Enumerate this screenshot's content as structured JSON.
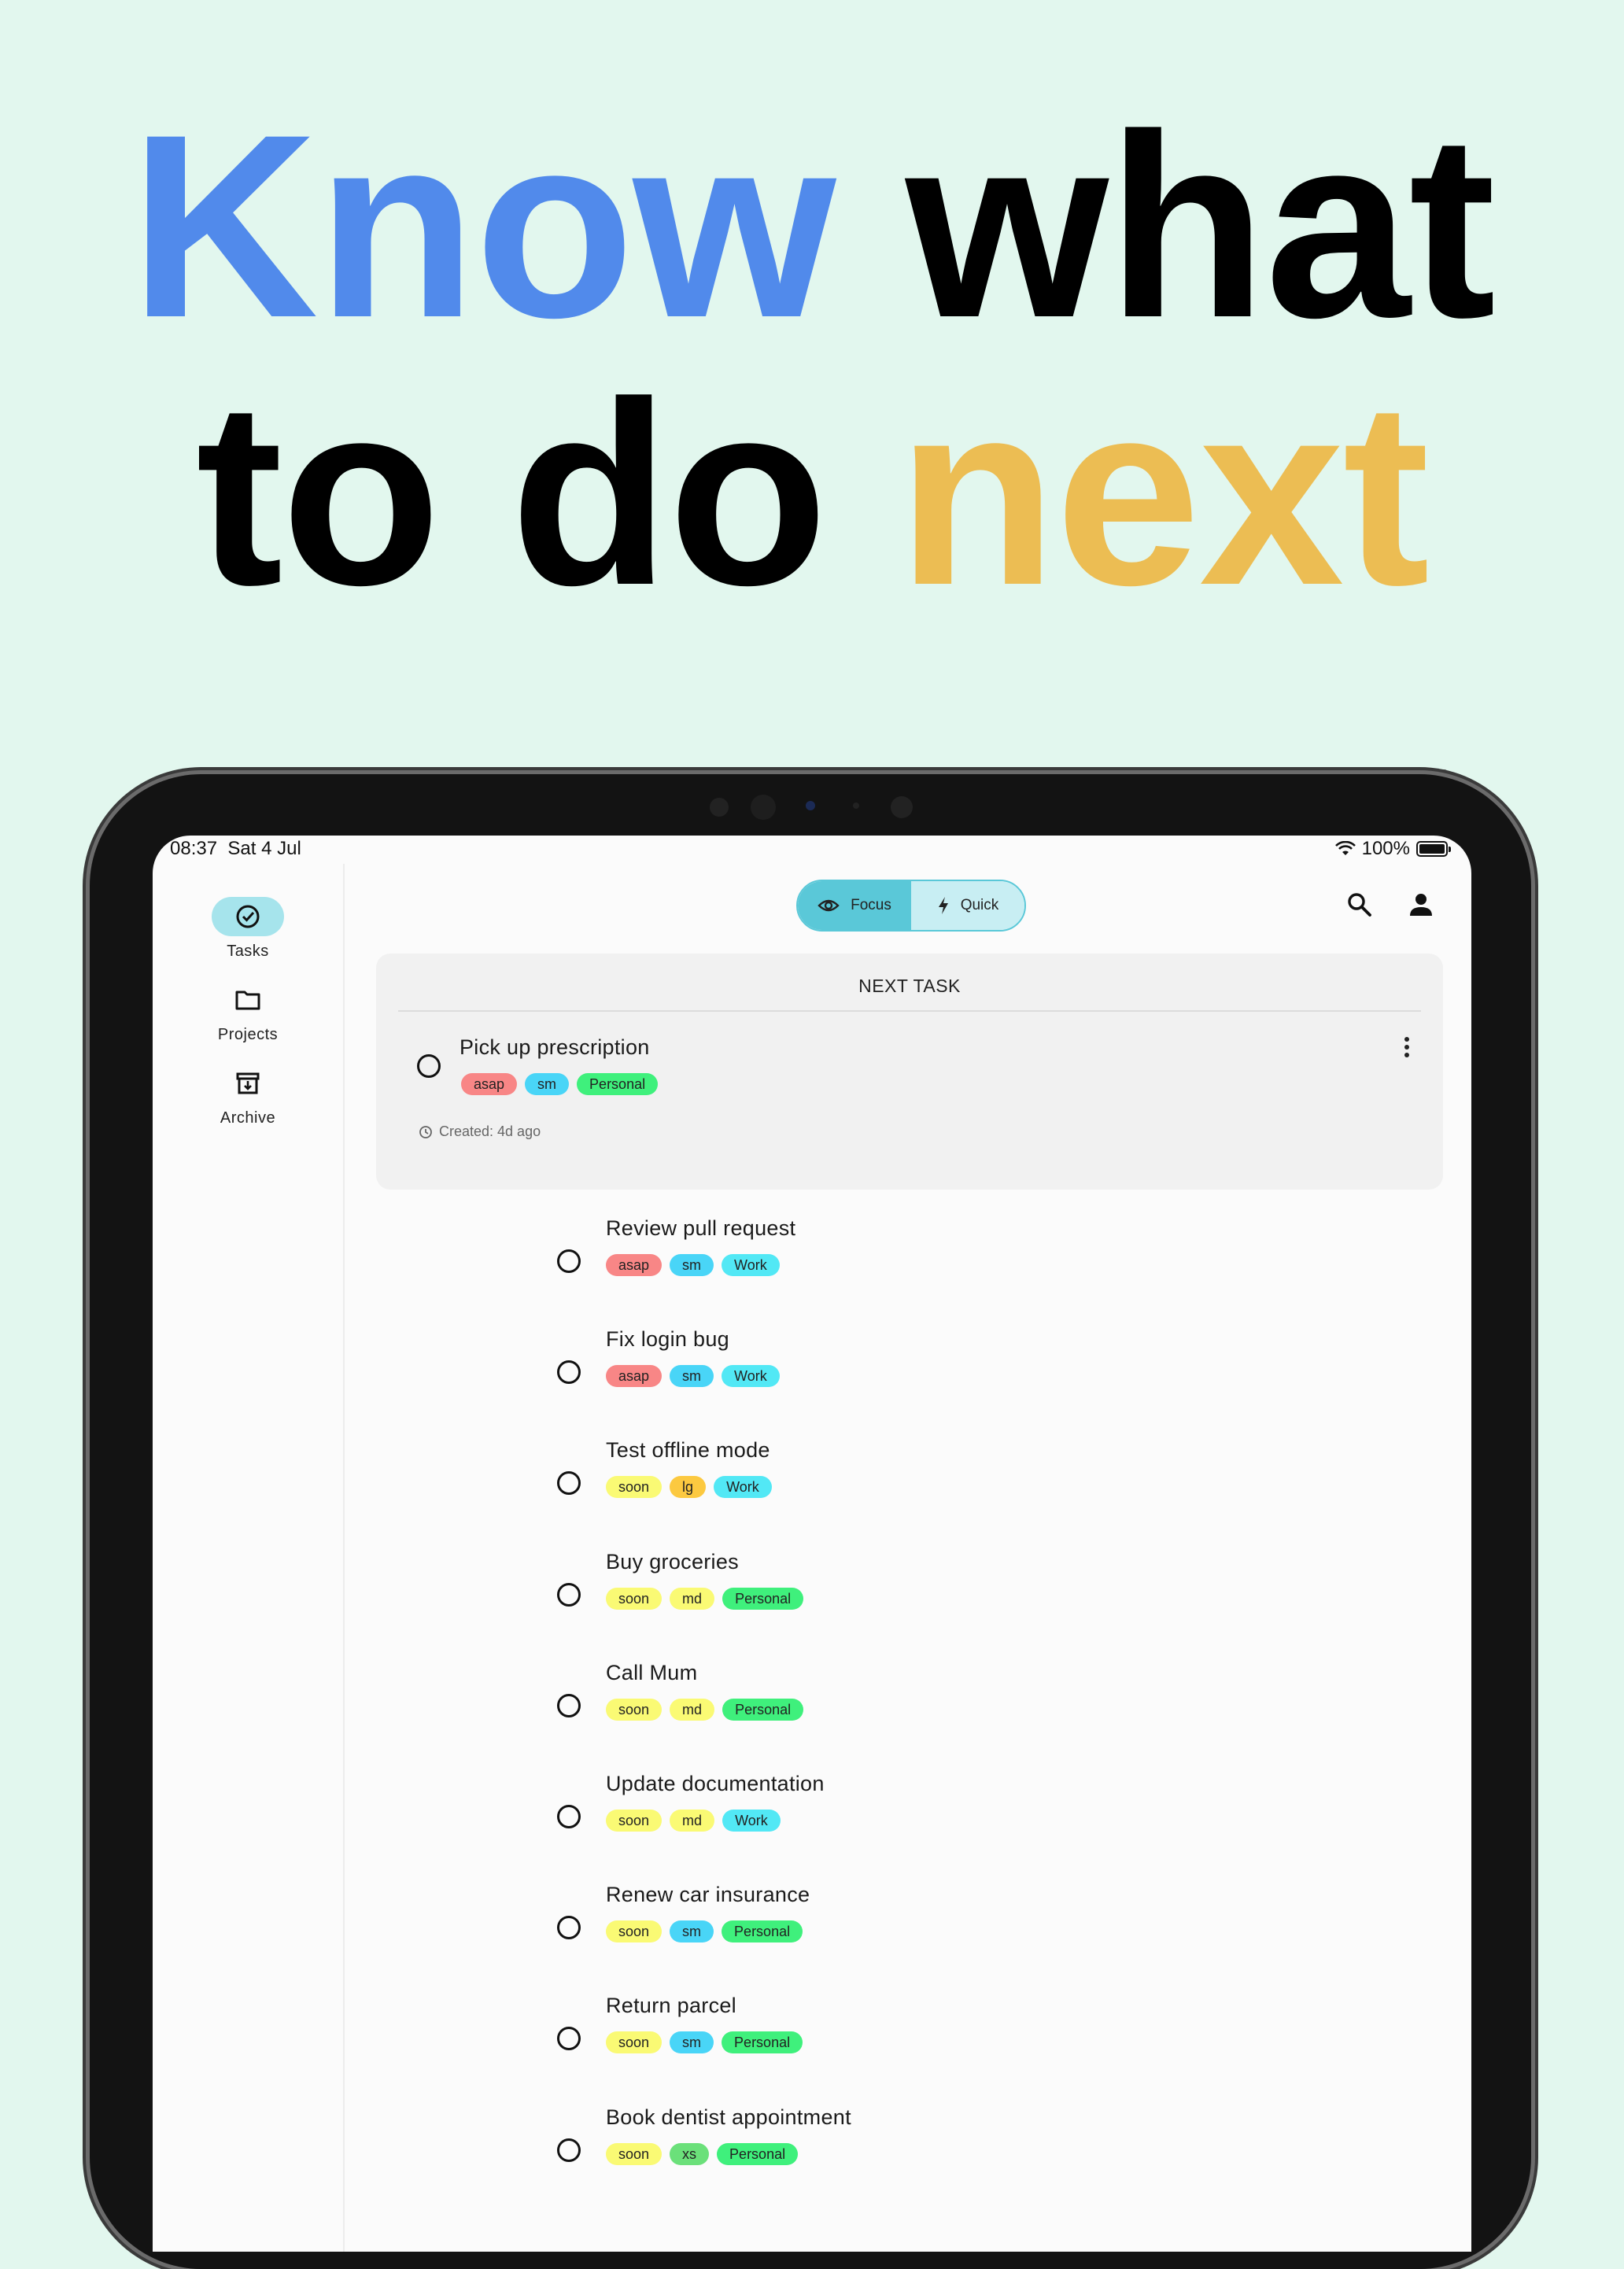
{
  "headline": {
    "line1": [
      {
        "text": "Know",
        "accent": "blue"
      },
      {
        "text": " what",
        "accent": "none"
      }
    ],
    "line2": [
      {
        "text": "to do ",
        "accent": "none"
      },
      {
        "text": "next",
        "accent": "yellow"
      }
    ]
  },
  "colors": {
    "background": "#e2f7ee",
    "accent_blue": "#518aeb",
    "accent_yellow": "#ecbd53",
    "toggle_active": "#5ac8d8",
    "nav_active": "#a6e4ec"
  },
  "status_bar": {
    "time": "08:37",
    "date": "Sat 4 Jul",
    "battery": "100%"
  },
  "nav": [
    {
      "label": "Tasks",
      "icon": "check-circle-icon",
      "active": true
    },
    {
      "label": "Projects",
      "icon": "folder-icon",
      "active": false
    },
    {
      "label": "Archive",
      "icon": "archive-icon",
      "active": false
    }
  ],
  "mode_toggle": {
    "focus": {
      "label": "Focus",
      "icon": "eye-icon",
      "selected": true
    },
    "quick": {
      "label": "Quick",
      "icon": "lightning-icon",
      "selected": false
    }
  },
  "toolbar": {
    "search_icon": "search-icon",
    "account_icon": "person-icon"
  },
  "next_task": {
    "heading": "NEXT TASK",
    "title": "Pick up prescription",
    "tags": [
      "asap",
      "sm",
      "Personal"
    ],
    "created": "Created: 4d ago"
  },
  "tag_colors": {
    "asap": "#f88686",
    "soon": "#fafa74",
    "sm": "#49d5f7",
    "md": "#fafa74",
    "lg": "#fcc940",
    "xs": "#6be07a",
    "Work": "#52e8f5",
    "Personal": "#3ff07c"
  },
  "tasks": [
    {
      "title": "Review pull request",
      "tags": [
        "asap",
        "sm",
        "Work"
      ]
    },
    {
      "title": "Fix login bug",
      "tags": [
        "asap",
        "sm",
        "Work"
      ]
    },
    {
      "title": "Test offline mode",
      "tags": [
        "soon",
        "lg",
        "Work"
      ]
    },
    {
      "title": "Buy groceries",
      "tags": [
        "soon",
        "md",
        "Personal"
      ]
    },
    {
      "title": "Call Mum",
      "tags": [
        "soon",
        "md",
        "Personal"
      ]
    },
    {
      "title": "Update documentation",
      "tags": [
        "soon",
        "md",
        "Work"
      ]
    },
    {
      "title": "Renew car insurance",
      "tags": [
        "soon",
        "sm",
        "Personal"
      ]
    },
    {
      "title": "Return parcel",
      "tags": [
        "soon",
        "sm",
        "Personal"
      ]
    },
    {
      "title": "Book dentist appointment",
      "tags": [
        "soon",
        "xs",
        "Personal"
      ]
    }
  ]
}
